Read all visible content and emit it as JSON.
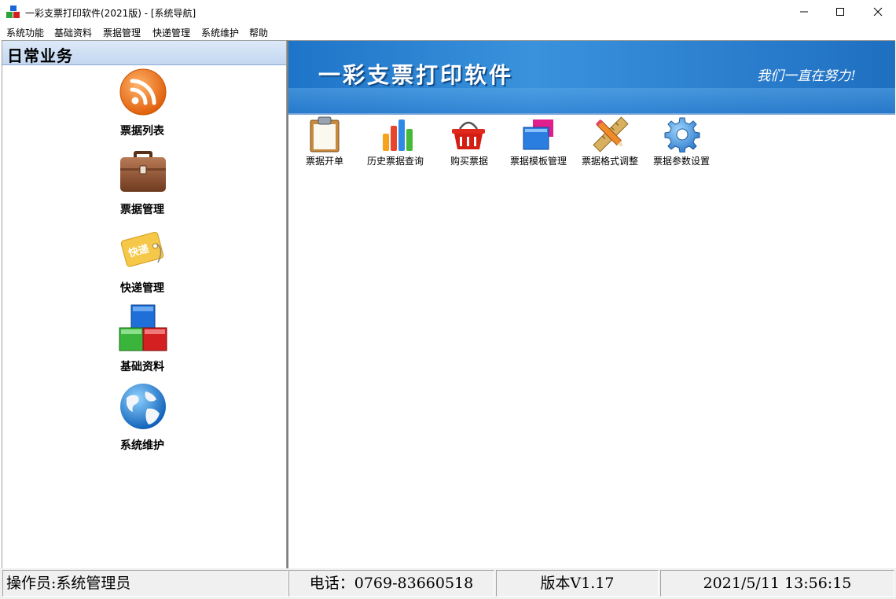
{
  "window": {
    "title": "一彩支票打印软件(2021版) - [系统导航]"
  },
  "menu": [
    "系统功能",
    "基础资料",
    "票据管理",
    "快递管理",
    "系统维护",
    "帮助"
  ],
  "left_panel": {
    "title": "日常业务",
    "items": [
      {
        "label": "票据列表",
        "icon": "rss-icon"
      },
      {
        "label": "票据管理",
        "icon": "briefcase-icon"
      },
      {
        "label": "快递管理",
        "icon": "express-tag-icon"
      },
      {
        "label": "基础资料",
        "icon": "blocks-icon"
      },
      {
        "label": "系统维护",
        "icon": "globe-icon"
      }
    ]
  },
  "banner": {
    "title": "一彩支票打印软件",
    "slogan": "我们一直在努力!"
  },
  "toolbar": [
    {
      "label": "票据开单",
      "icon": "clipboard-icon"
    },
    {
      "label": "历史票据查询",
      "icon": "bar-chart-icon"
    },
    {
      "label": "购买票据",
      "icon": "basket-icon"
    },
    {
      "label": "票据模板管理",
      "icon": "template-icon"
    },
    {
      "label": "票据格式调整",
      "icon": "ruler-pencil-icon"
    },
    {
      "label": "票据参数设置",
      "icon": "gear-icon"
    }
  ],
  "status": {
    "operator": "操作员:系统管理员",
    "phone": "电话：0769-83660518",
    "version": "版本V1.17",
    "datetime": "2021/5/11 13:56:15"
  },
  "colors": {
    "banner": "#2a84d4",
    "accent_orange": "#f07a1c"
  }
}
